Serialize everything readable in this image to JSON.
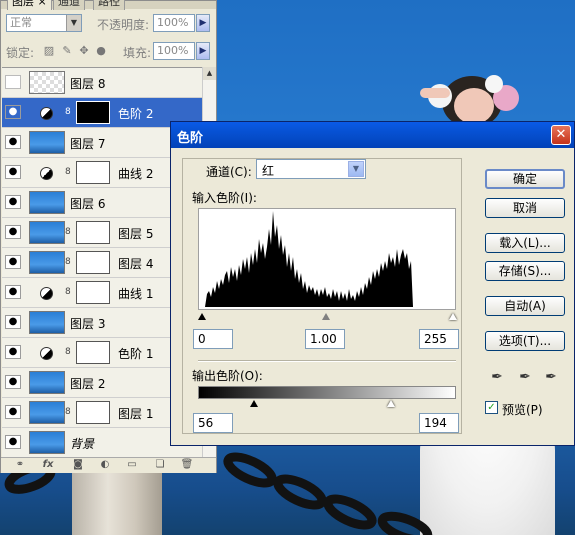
{
  "layers_panel": {
    "tabs": [
      "图层",
      "通道",
      "路径"
    ],
    "tab_close": "×",
    "blend_mode": "正常",
    "opacity_label": "不透明度:",
    "opacity_value": "100%",
    "lock_label": "锁定:",
    "fill_label": "填充:",
    "fill_value": "100%",
    "layers": [
      {
        "name": "图层 8",
        "type": "pixel",
        "visible": false,
        "selected": false
      },
      {
        "name": "色阶 2",
        "type": "adjustment",
        "visible": true,
        "selected": true
      },
      {
        "name": "图层 7",
        "type": "pixel",
        "visible": true,
        "selected": false
      },
      {
        "name": "曲线 2",
        "type": "adjustment",
        "visible": true,
        "selected": false
      },
      {
        "name": "图层 6",
        "type": "pixel",
        "visible": true,
        "selected": false
      },
      {
        "name": "图层 5",
        "type": "pixel-mask",
        "visible": true,
        "selected": false
      },
      {
        "name": "图层 4",
        "type": "pixel-mask",
        "visible": true,
        "selected": false
      },
      {
        "name": "曲线 1",
        "type": "adjustment",
        "visible": true,
        "selected": false
      },
      {
        "name": "图层 3",
        "type": "pixel",
        "visible": true,
        "selected": false
      },
      {
        "name": "色阶 1",
        "type": "adjustment",
        "visible": true,
        "selected": false
      },
      {
        "name": "图层 2",
        "type": "pixel",
        "visible": true,
        "selected": false
      },
      {
        "name": "图层 1",
        "type": "pixel-mask",
        "visible": true,
        "selected": false
      },
      {
        "name": "背景",
        "type": "pixel",
        "visible": true,
        "selected": false
      }
    ],
    "bottom_icons": [
      "link-icon",
      "fx-icon",
      "mask-icon",
      "adjustment-icon",
      "folder-icon",
      "new-layer-icon",
      "trash-icon"
    ],
    "bottom_fx": "fx"
  },
  "levels_dialog": {
    "title": "色阶",
    "close": "✕",
    "channel_label": "通道(C):",
    "channel_value": "红",
    "input_levels_label": "输入色阶(I):",
    "input_black": "0",
    "input_gamma": "1.00",
    "input_white": "255",
    "output_levels_label": "输出色阶(O):",
    "output_black": "56",
    "output_white": "194",
    "buttons": {
      "ok": "确定",
      "cancel": "取消",
      "load": "载入(L)...",
      "save": "存储(S)...",
      "auto": "自动(A)",
      "options": "选项(T)..."
    },
    "preview_label": "预览(P)",
    "preview_checked": true
  },
  "colors": {
    "title_bar": "#0553d6",
    "selected_layer": "#3468c8",
    "sky": "#2b7fd4"
  }
}
